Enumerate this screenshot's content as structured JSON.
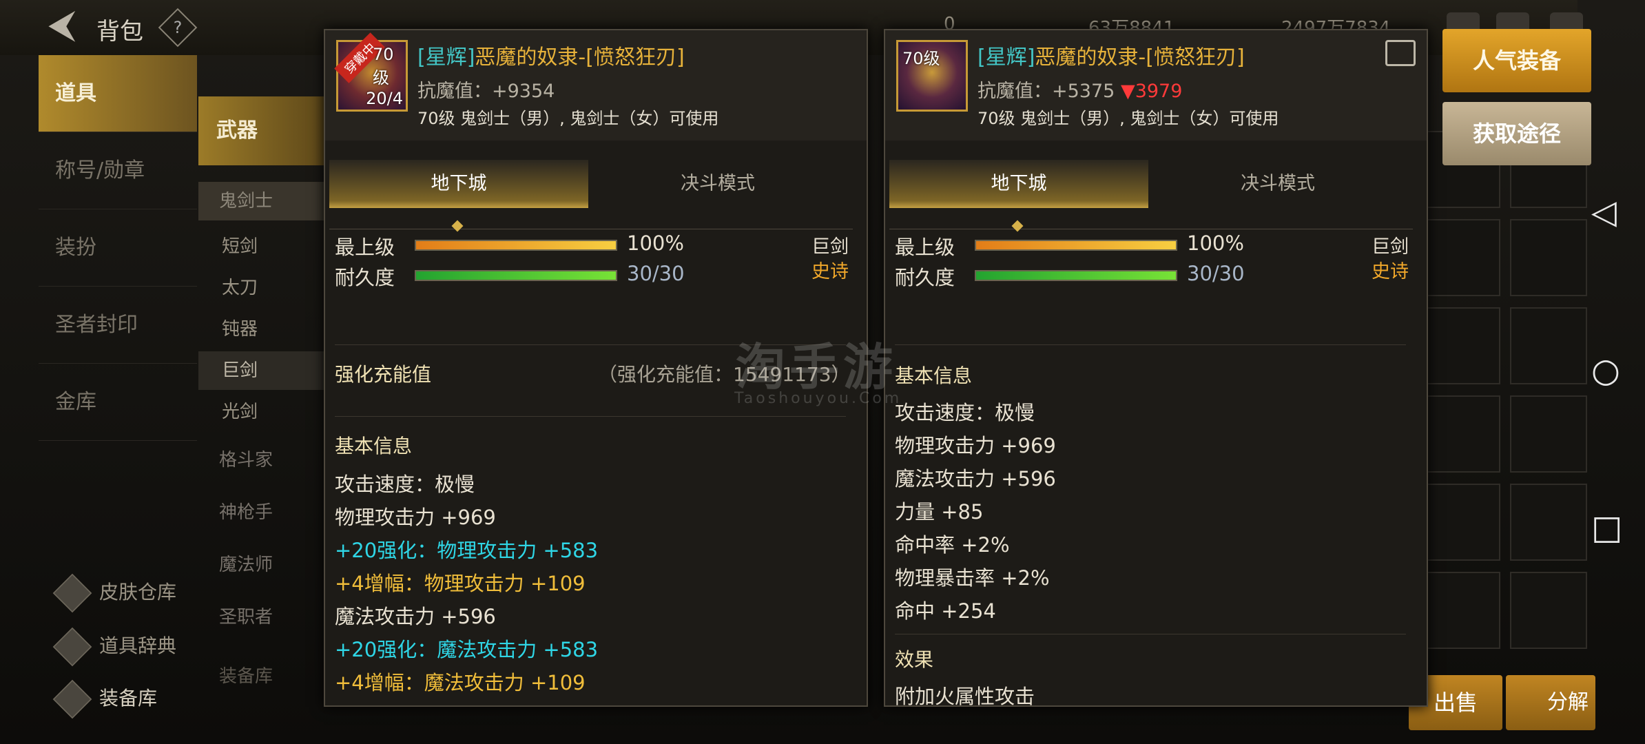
{
  "header": {
    "title": "背包",
    "help": "?",
    "currencies": [
      "0",
      "63万8841",
      "2497万7834"
    ]
  },
  "sidebar": {
    "items": [
      {
        "label": "道具",
        "active": true
      },
      {
        "label": "称号/勋章"
      },
      {
        "label": "装扮"
      },
      {
        "label": "圣者封印"
      },
      {
        "label": "金库"
      }
    ],
    "tools": [
      "皮肤仓库",
      "道具辞典",
      "装备库"
    ]
  },
  "categories": {
    "head": "武器",
    "classes": [
      "鬼剑士",
      "格斗家",
      "神枪手",
      "魔法师",
      "圣职者"
    ],
    "weapons": [
      "短剑",
      "太刀",
      "钝器",
      "巨剑",
      "光剑"
    ],
    "footer": "装备库"
  },
  "buttons": {
    "popular": "人气装备",
    "source": "获取途径",
    "sell": "出售",
    "decompose": "分解"
  },
  "watermark": {
    "main": "淘手游",
    "sub": "Taoshouyou.Com"
  },
  "left_panel": {
    "icon": {
      "level": "70级",
      "count": "20/4",
      "equipped": "穿戴中"
    },
    "name_tag": "[星辉]",
    "name": "恶魔的奴隶-[愤怒狂刃]",
    "resist": "抗魔值：+9354",
    "usable": "70级 鬼剑士（男）, 鬼剑士（女）可使用",
    "tabs": [
      "地下城",
      "决斗模式"
    ],
    "grade_label": "最上级",
    "grade_pct": "100%",
    "grade_fraction": 1.0,
    "durability_label": "耐久度",
    "durability_val": "30/30",
    "durability_fraction": 1.0,
    "weapon_type": "巨剑",
    "rarity": "史诗",
    "charge_label": "强化充能值",
    "charge_value": "（强化充能值：15491173）",
    "basic_title": "基本信息",
    "lines": [
      {
        "text": "攻击速度：极慢",
        "color": "white"
      },
      {
        "text": "物理攻击力 +969",
        "color": "white"
      },
      {
        "text": "+20强化：物理攻击力 +583",
        "color": "cyan"
      },
      {
        "text": " +4增幅：物理攻击力 +109",
        "color": "gold"
      },
      {
        "text": "魔法攻击力 +596",
        "color": "white"
      },
      {
        "text": "+20强化：魔法攻击力 +583",
        "color": "cyan"
      },
      {
        "text": " +4增幅：魔法攻击力 +109",
        "color": "gold"
      }
    ]
  },
  "right_panel": {
    "icon": {
      "level": "70级"
    },
    "name_tag": "[星辉]",
    "name": "恶魔的奴隶-[愤怒狂刃]",
    "resist": "抗魔值：+5375",
    "resist_diff": "▼3979",
    "usable": "70级 鬼剑士（男）, 鬼剑士（女）可使用",
    "tabs": [
      "地下城",
      "决斗模式"
    ],
    "grade_label": "最上级",
    "grade_pct": "100%",
    "grade_fraction": 1.0,
    "durability_label": "耐久度",
    "durability_val": "30/30",
    "durability_fraction": 1.0,
    "weapon_type": "巨剑",
    "rarity": "史诗",
    "basic_title": "基本信息",
    "lines": [
      "攻击速度：极慢",
      "物理攻击力 +969",
      "魔法攻击力 +596",
      "力量 +85",
      "命中率 +2%",
      "物理暴击率 +2%",
      "命中 +254"
    ],
    "effect_title": "效果",
    "effect_line": "附加火属性攻击"
  }
}
